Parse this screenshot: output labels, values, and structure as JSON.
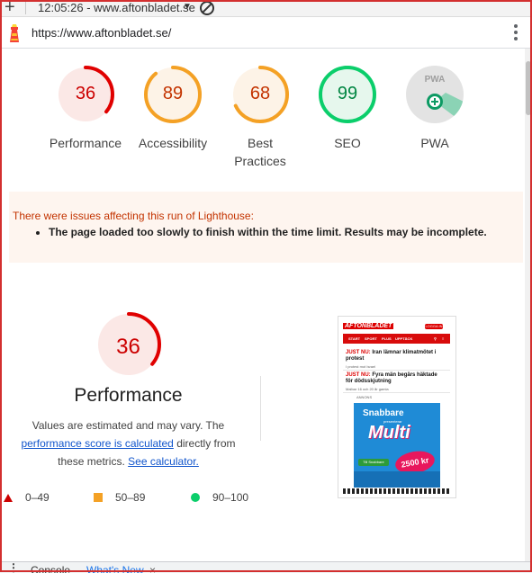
{
  "topbar": {
    "title": "12:05:26 - www.aftonbladet.se"
  },
  "urlbar": {
    "url": "https://www.aftonbladet.se/"
  },
  "colors": {
    "fail": "#cc0000",
    "average": "#f4a125",
    "pass": "#0bce6b",
    "pwa": "#9e9e9e"
  },
  "gauges": [
    {
      "score": "36",
      "label": "Performance",
      "value": 0.36,
      "status": "fail"
    },
    {
      "score": "89",
      "label": "Accessibility",
      "value": 0.89,
      "status": "average"
    },
    {
      "score": "68",
      "label": "Best Practices",
      "value": 0.68,
      "status": "average"
    },
    {
      "score": "99",
      "label": "SEO",
      "value": 0.99,
      "status": "pass"
    },
    {
      "score": "PWA",
      "label": "PWA",
      "status": "pwa"
    }
  ],
  "warning": {
    "message": "There were issues affecting this run of Lighthouse:",
    "items": [
      "The page loaded too slowly to finish within the time limit. Results may be incomplete."
    ]
  },
  "performance": {
    "score": "36",
    "value": 0.36,
    "title": "Performance",
    "desc_before": "Values are estimated and may vary. The",
    "link1": "performance score is calculated",
    "desc_middle": "directly from these metrics.",
    "link2": "See calculator."
  },
  "legend": {
    "fail": "0–49",
    "average": "50–89",
    "pass": "90–100"
  },
  "screenshot": {
    "logo": "AFTONBLADET",
    "login": "LOGGA IN",
    "nav": [
      "START",
      "SPORT",
      "PLUS",
      "UPPTÄCK"
    ],
    "news": [
      {
        "tag": "JUST NU:",
        "text": "Iran lämnar klimatmötet i protest",
        "sub": "I protest mot Israel"
      },
      {
        "tag": "JUST NU:",
        "text": "Fyra män begärs häktade för dödsskjutning",
        "sub": "Malbar 16 och 20 år gamla"
      }
    ],
    "ad_label": "ANNONS",
    "ad_brand": "Snabbare",
    "ad_presents": "presenterar",
    "ad_title": "Multi",
    "ad_bonus": "2500 kr",
    "ad_cta": "Till Snabbare"
  },
  "devtools": {
    "console": "Console",
    "whatsnew": "What's New"
  }
}
